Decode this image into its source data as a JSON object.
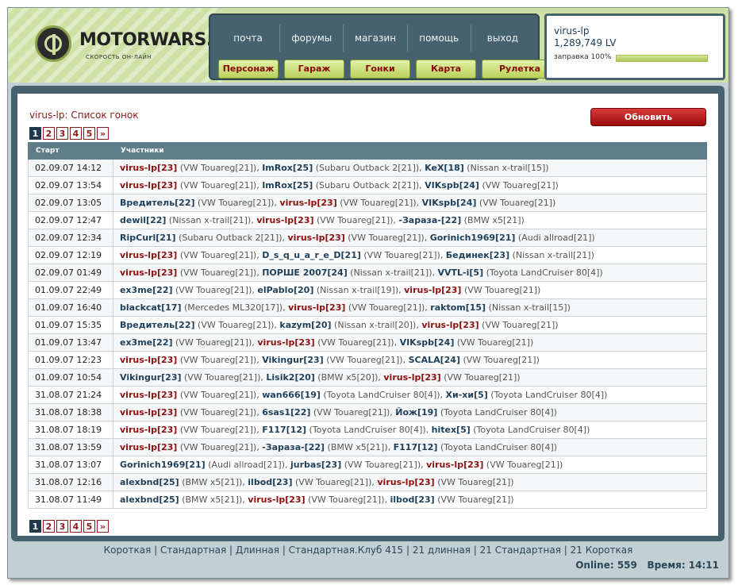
{
  "brand": {
    "name": "MOTORWARS.RU",
    "tagline": "СКОРОСТЬ ОН-ЛАЙН"
  },
  "nav_top": [
    "почта",
    "форумы",
    "магазин",
    "помощь",
    "выход"
  ],
  "nav_main": [
    "Персонаж",
    "Гараж",
    "Гонки",
    "Карта",
    "Рулетка"
  ],
  "user": {
    "name": "virus-lp",
    "money": "1,289,749 LV",
    "fuel_label": "заправка 100%",
    "fuel_fraction": 1.0
  },
  "page": {
    "title": "virus-lp: Список гонок",
    "refresh_label": "Обновить"
  },
  "pager": [
    "1",
    "2",
    "3",
    "4",
    "5",
    "»"
  ],
  "table": {
    "headers": [
      "Старт",
      "Участники"
    ],
    "rows": [
      {
        "start": "02.09.07 14:12",
        "p": [
          [
            "virus-lp[23]",
            "VW Touareg[21]",
            1
          ],
          [
            "ImRox[25]",
            "Subaru Outback 2[21]",
            0
          ],
          [
            "KeX[18]",
            "Nissan x-trail[15]",
            0
          ]
        ]
      },
      {
        "start": "02.09.07 13:54",
        "p": [
          [
            "virus-lp[23]",
            "VW Touareg[21]",
            1
          ],
          [
            "ImRox[25]",
            "Subaru Outback 2[21]",
            0
          ],
          [
            "VIKspb[24]",
            "VW Touareg[21]",
            0
          ]
        ]
      },
      {
        "start": "02.09.07 13:05",
        "p": [
          [
            "Вредитель[22]",
            "VW Touareg[21]",
            0
          ],
          [
            "virus-lp[23]",
            "VW Touareg[21]",
            1
          ],
          [
            "VIKspb[24]",
            "VW Touareg[21]",
            0
          ]
        ]
      },
      {
        "start": "02.09.07 12:47",
        "p": [
          [
            "dewil[22]",
            "Nissan x-trail[21]",
            0
          ],
          [
            "virus-lp[23]",
            "VW Touareg[21]",
            1
          ],
          [
            "-Зараза-[22]",
            "BMW x5[21]",
            0
          ]
        ]
      },
      {
        "start": "02.09.07 12:34",
        "p": [
          [
            "RipCurl[21]",
            "Subaru Outback 2[21]",
            0
          ],
          [
            "virus-lp[23]",
            "VW Touareg[21]",
            1
          ],
          [
            "Gorinich1969[21]",
            "Audi allroad[21]",
            0
          ]
        ]
      },
      {
        "start": "02.09.07 12:19",
        "p": [
          [
            "virus-lp[23]",
            "VW Touareg[21]",
            1
          ],
          [
            "D_s_q_u_a_r_e_D[21]",
            "VW Touareg[21]",
            0
          ],
          [
            "Бединек[23]",
            "Nissan x-trail[21]",
            0
          ]
        ]
      },
      {
        "start": "02.09.07 01:49",
        "p": [
          [
            "virus-lp[23]",
            "VW Touareg[21]",
            1
          ],
          [
            "ПОРШЕ 2007[24]",
            "Nissan x-trail[21]",
            0
          ],
          [
            "VVTL-i[5]",
            "Toyota LandCruiser 80[4]",
            0
          ]
        ]
      },
      {
        "start": "01.09.07 22:49",
        "p": [
          [
            "ex3me[22]",
            "VW Touareg[21]",
            0
          ],
          [
            "elPablo[20]",
            "Nissan x-trail[19]",
            0
          ],
          [
            "virus-lp[23]",
            "VW Touareg[21]",
            1
          ]
        ]
      },
      {
        "start": "01.09.07 16:40",
        "p": [
          [
            "blackcat[17]",
            "Mercedes ML320[17]",
            0
          ],
          [
            "virus-lp[23]",
            "VW Touareg[21]",
            1
          ],
          [
            "raktom[15]",
            "Nissan x-trail[15]",
            0
          ]
        ]
      },
      {
        "start": "01.09.07 15:35",
        "p": [
          [
            "Вредитель[22]",
            "VW Touareg[21]",
            0
          ],
          [
            "kazym[20]",
            "Nissan x-trail[20]",
            0
          ],
          [
            "virus-lp[23]",
            "VW Touareg[21]",
            1
          ]
        ]
      },
      {
        "start": "01.09.07 13:47",
        "p": [
          [
            "ex3me[22]",
            "VW Touareg[21]",
            0
          ],
          [
            "virus-lp[23]",
            "VW Touareg[21]",
            1
          ],
          [
            "VIKspb[24]",
            "VW Touareg[21]",
            0
          ]
        ]
      },
      {
        "start": "01.09.07 12:23",
        "p": [
          [
            "virus-lp[23]",
            "VW Touareg[21]",
            1
          ],
          [
            "Vikingur[23]",
            "VW Touareg[21]",
            0
          ],
          [
            "SCALA[24]",
            "VW Touareg[21]",
            0
          ]
        ]
      },
      {
        "start": "01.09.07 10:54",
        "p": [
          [
            "Vikingur[23]",
            "VW Touareg[21]",
            0
          ],
          [
            "Lisik2[20]",
            "BMW x5[20]",
            0
          ],
          [
            "virus-lp[23]",
            "VW Touareg[21]",
            1
          ]
        ]
      },
      {
        "start": "31.08.07 21:24",
        "p": [
          [
            "virus-lp[23]",
            "VW Touareg[21]",
            1
          ],
          [
            "wan666[19]",
            "Toyota LandCruiser 80[4]",
            0
          ],
          [
            "Хи-хи[5]",
            "Toyota LandCruiser 80[4]",
            0
          ]
        ]
      },
      {
        "start": "31.08.07 18:38",
        "p": [
          [
            "virus-lp[23]",
            "VW Touareg[21]",
            1
          ],
          [
            "6sas1[22]",
            "VW Touareg[21]",
            0
          ],
          [
            "Йож[19]",
            "Toyota LandCruiser 80[4]",
            0
          ]
        ]
      },
      {
        "start": "31.08.07 18:19",
        "p": [
          [
            "virus-lp[23]",
            "VW Touareg[21]",
            1
          ],
          [
            "F117[12]",
            "Toyota LandCruiser 80[4]",
            0
          ],
          [
            "hitex[5]",
            "Toyota LandCruiser 80[4]",
            0
          ]
        ]
      },
      {
        "start": "31.08.07 13:59",
        "p": [
          [
            "virus-lp[23]",
            "VW Touareg[21]",
            1
          ],
          [
            "-Зараза-[22]",
            "BMW x5[21]",
            0
          ],
          [
            "F117[12]",
            "Toyota LandCruiser 80[4]",
            0
          ]
        ]
      },
      {
        "start": "31.08.07 13:07",
        "p": [
          [
            "Gorinich1969[21]",
            "Audi allroad[21]",
            0
          ],
          [
            "jurbas[23]",
            "VW Touareg[21]",
            0
          ],
          [
            "virus-lp[23]",
            "VW Touareg[21]",
            1
          ]
        ]
      },
      {
        "start": "31.08.07 12:16",
        "p": [
          [
            "alexbnd[25]",
            "BMW x5[21]",
            0
          ],
          [
            "ilbod[23]",
            "VW Touareg[21]",
            0
          ],
          [
            "virus-lp[23]",
            "VW Touareg[21]",
            1
          ]
        ]
      },
      {
        "start": "31.08.07 11:49",
        "p": [
          [
            "alexbnd[25]",
            "BMW x5[21]",
            0
          ],
          [
            "virus-lp[23]",
            "VW Touareg[21]",
            1
          ],
          [
            "ilbod[23]",
            "VW Touareg[21]",
            0
          ]
        ]
      }
    ]
  },
  "footer": {
    "links": [
      "Короткая",
      "Стандартная",
      "Длинная",
      "Стандартная.Клуб 415",
      "21 длинная",
      "21 Стандартная",
      "21 Короткая"
    ],
    "online_label": "Online: 559",
    "time_label": "Время: 14:11"
  }
}
